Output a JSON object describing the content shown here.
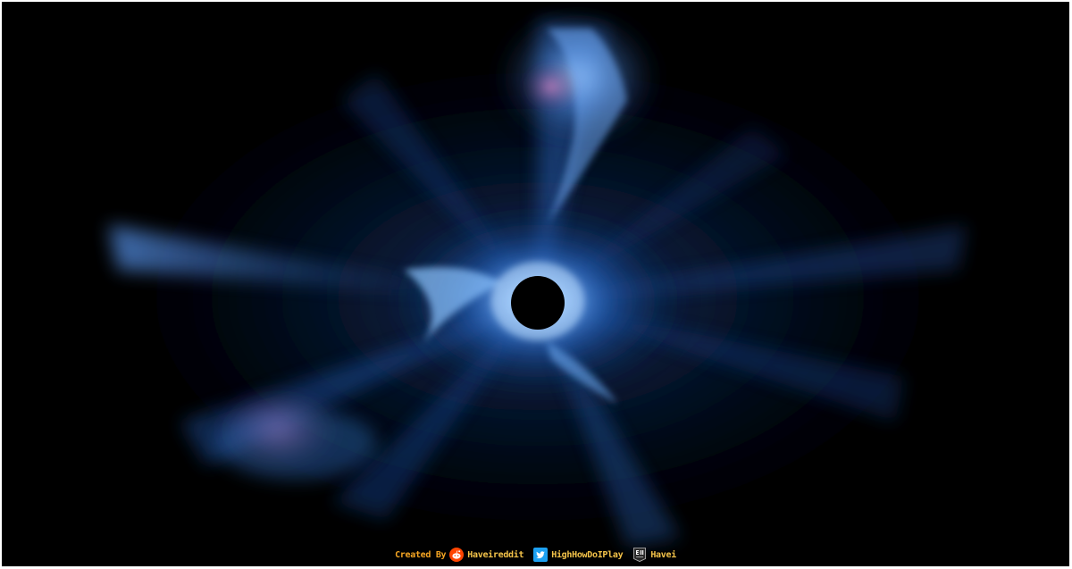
{
  "scene": {
    "colors": {
      "background": "#000000",
      "glow_primary": "#2b6fd6",
      "glow_bright": "#7fb8ff",
      "glow_pink": "#c86aa8",
      "hole": "#000000"
    }
  },
  "credits": {
    "created_by": "Created By",
    "reddit_icon": "reddit-icon",
    "reddit_handle": "Haveireddit",
    "twitter_icon": "twitter-icon",
    "twitter_handle": "HighHowDoIPlay",
    "epic_icon": "epic-games-icon",
    "epic_handle": "Havei",
    "colors": {
      "label": "#f6a623",
      "handle": "#f5c44a",
      "reddit": "#ff4500",
      "twitter": "#1da1f2",
      "epic": "#2a2a2a"
    }
  }
}
